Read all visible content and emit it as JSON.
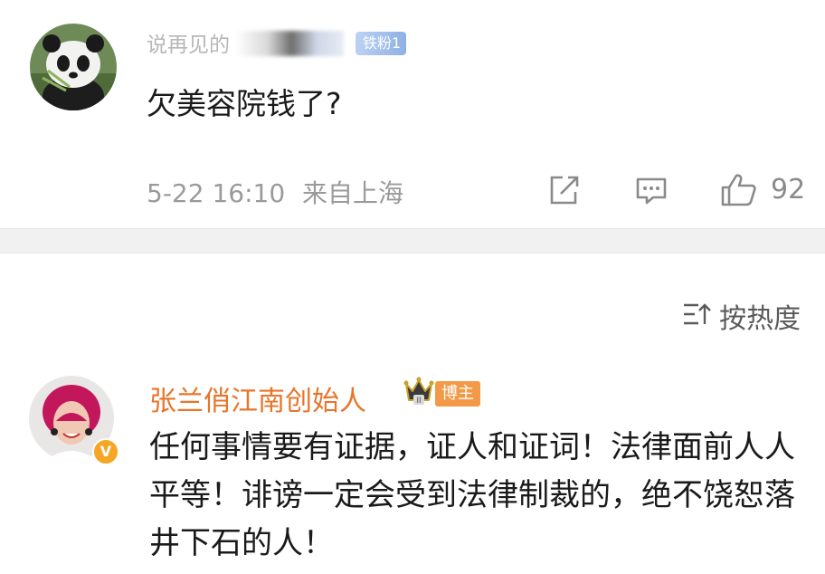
{
  "comment1": {
    "username": "说再见的",
    "fan_badge": "铁粉1",
    "text": "欠美容院钱了?",
    "time": "5-22 16:10",
    "location": "来自上海",
    "like_count": "92"
  },
  "sort": {
    "label": "按热度"
  },
  "comment2": {
    "username": "张兰俏江南创始人",
    "host_badge": "博主",
    "crown_level": "II",
    "verified_mark": "V",
    "text": "任何事情要有证据，证人和证词！法律面前人人平等！诽谤一定会受到法律制裁的，绝不饶恕落井下石的人！"
  },
  "icons": [
    "panda-avatar-icon",
    "share-icon",
    "comment-icon",
    "thumbs-up-icon",
    "sort-icon",
    "crown-icon",
    "verified-icon"
  ],
  "colors": {
    "owner_name": "#e8742a",
    "host_badge": "#f29a47",
    "fan_badge": "#9cbbe9",
    "meta_text": "#9a9a9a"
  }
}
